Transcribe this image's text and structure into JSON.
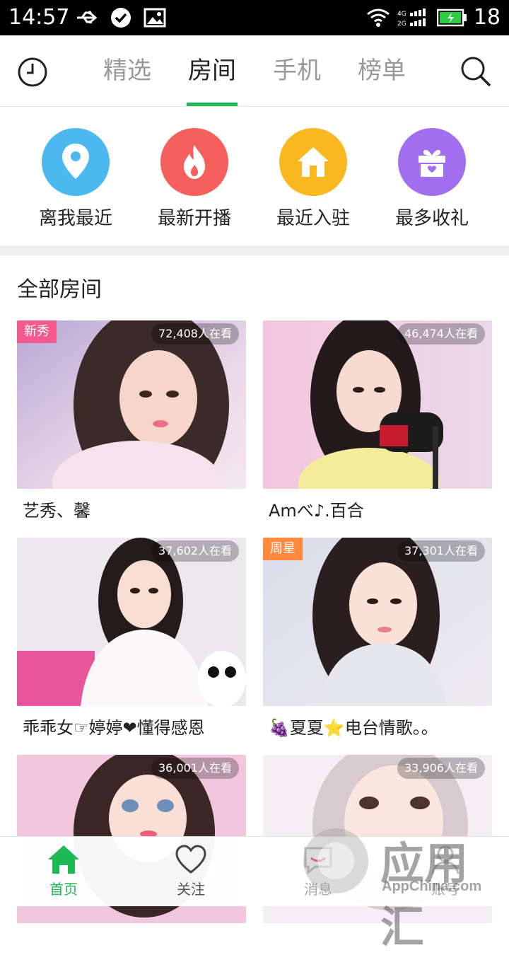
{
  "status_bar": {
    "time": "14:57",
    "battery": "18",
    "network": "4G"
  },
  "top_nav": {
    "tabs": [
      {
        "label": "精选"
      },
      {
        "label": "房间"
      },
      {
        "label": "手机"
      },
      {
        "label": "榜单"
      }
    ],
    "active_tab": "房间"
  },
  "categories": [
    {
      "label": "离我最近",
      "icon": "location-pin-icon",
      "color": "#47b7f0"
    },
    {
      "label": "最新开播",
      "icon": "flame-icon",
      "color": "#f55f5c"
    },
    {
      "label": "最近入驻",
      "icon": "house-icon",
      "color": "#f9b81f"
    },
    {
      "label": "最多收礼",
      "icon": "gift-icon",
      "color": "#a26ef0"
    }
  ],
  "section_title": "全部房间",
  "rooms": [
    {
      "title": "艺秀、馨",
      "viewers": "72,408人在看",
      "badge": "新秀",
      "badge_color": "#f45a8d"
    },
    {
      "title": "Amべ♪.百合",
      "viewers": "46,474人在看",
      "badge": "",
      "badge_color": ""
    },
    {
      "title": "乖乖女☞婷婷❤懂得感恩",
      "viewers": "37,602人在看",
      "badge": "",
      "badge_color": ""
    },
    {
      "title": "🍇夏夏⭐电台情歌。。",
      "viewers": "37,301人在看",
      "badge": "周星",
      "badge_color": "#ff8a3d"
    },
    {
      "title": "",
      "viewers": "36,001人在看",
      "badge": "",
      "badge_color": ""
    },
    {
      "title": "",
      "viewers": "33,906人在看",
      "badge": "",
      "badge_color": ""
    }
  ],
  "bottom_nav": [
    {
      "label": "首页",
      "icon": "home-icon"
    },
    {
      "label": "关注",
      "icon": "heart-icon"
    },
    {
      "label": "消息",
      "icon": "message-icon"
    },
    {
      "label": "账号",
      "icon": "account-icon"
    }
  ],
  "colors": {
    "accent": "#1db954"
  },
  "watermark": {
    "text": "应用汇",
    "site": "AppChina.com"
  }
}
